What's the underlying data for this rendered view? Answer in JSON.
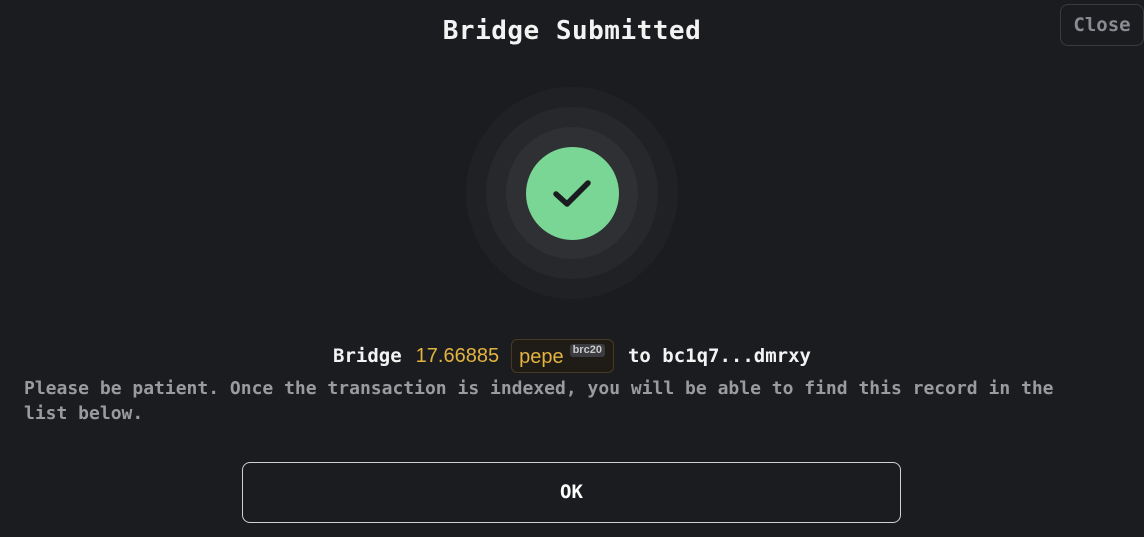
{
  "dialog": {
    "title": "Bridge Submitted",
    "close_label": "Close",
    "status_icon": "check-icon",
    "summary": {
      "prefix": "Bridge",
      "amount": "17.66885",
      "token": "pepe",
      "token_badge": "brc20",
      "to_label": "to bc1q7...dmrxy"
    },
    "note": "Please be patient. Once the transaction is indexed, you will be able to find this record in the list below.",
    "ok_label": "OK"
  },
  "colors": {
    "background": "#1b1c1f",
    "success": "#7ad695",
    "accent_amount": "#e3b341",
    "muted_text": "#9a9b9f"
  }
}
